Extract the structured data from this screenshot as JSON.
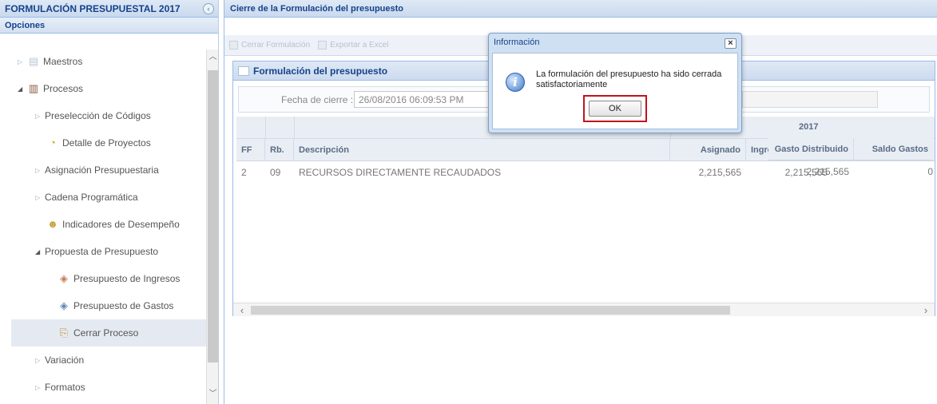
{
  "left": {
    "title": "FORMULACIÓN PRESUPUESTAL 2017",
    "collapse_icon": "chevron-left-icon",
    "opciones": "Opciones",
    "tree": [
      {
        "label": "Maestros",
        "icon": "folder-icon"
      },
      {
        "label": "Procesos",
        "icon": "books-icon"
      },
      {
        "label": "Preselección de Códigos",
        "icon": "arrow-icon"
      },
      {
        "label": "Detalle de Proyectos",
        "icon": "pie-icon"
      },
      {
        "label": "Asignación Presupuestaria",
        "icon": "arrow-icon"
      },
      {
        "label": "Cadena Programática",
        "icon": "arrow-icon"
      },
      {
        "label": "Indicadores de Desempeño",
        "icon": "person-icon"
      },
      {
        "label": "Propuesta de Presupuesto",
        "icon": "arrow-icon"
      },
      {
        "label": "Presupuesto de Ingresos",
        "icon": "money-icon"
      },
      {
        "label": "Presupuesto de Gastos",
        "icon": "money-icon"
      },
      {
        "label": "Cerrar Proceso",
        "icon": "close-process-icon"
      },
      {
        "label": "Variación",
        "icon": "arrow-icon"
      },
      {
        "label": "Formatos",
        "icon": "arrow-icon"
      }
    ]
  },
  "right": {
    "title": "Cierre de la Formulación del presupuesto",
    "toolbar": {
      "cerrar_label": "Cerrar Formulación",
      "exportar_label": "Exportar a Excel"
    },
    "form": {
      "title": "Formulación del presupuesto",
      "fecha_label": "Fecha de cierre :",
      "fecha_value": "26/08/2016 06:09:53 PM"
    },
    "grid": {
      "year": "2017",
      "columns": [
        "FF",
        "Rb.",
        "Descripción",
        "Asignado",
        "Ingreso Distribuido",
        "Gasto Distribuido",
        "Saldo Gastos"
      ],
      "rows": [
        {
          "ff": "2",
          "rb": "09",
          "descripcion": "RECURSOS DIRECTAMENTE RECAUDADOS",
          "asignado": "2,215,565",
          "ingreso": "2,215,565",
          "gasto": "2,215,565",
          "saldo": "0"
        }
      ]
    }
  },
  "modal": {
    "title": "Información",
    "close_label": "×",
    "icon": "info-icon",
    "message": "La formulación del presupuesto ha sido cerrada satisfactoriamente",
    "ok_label": "OK",
    "highlight_color": "#c0141c"
  }
}
